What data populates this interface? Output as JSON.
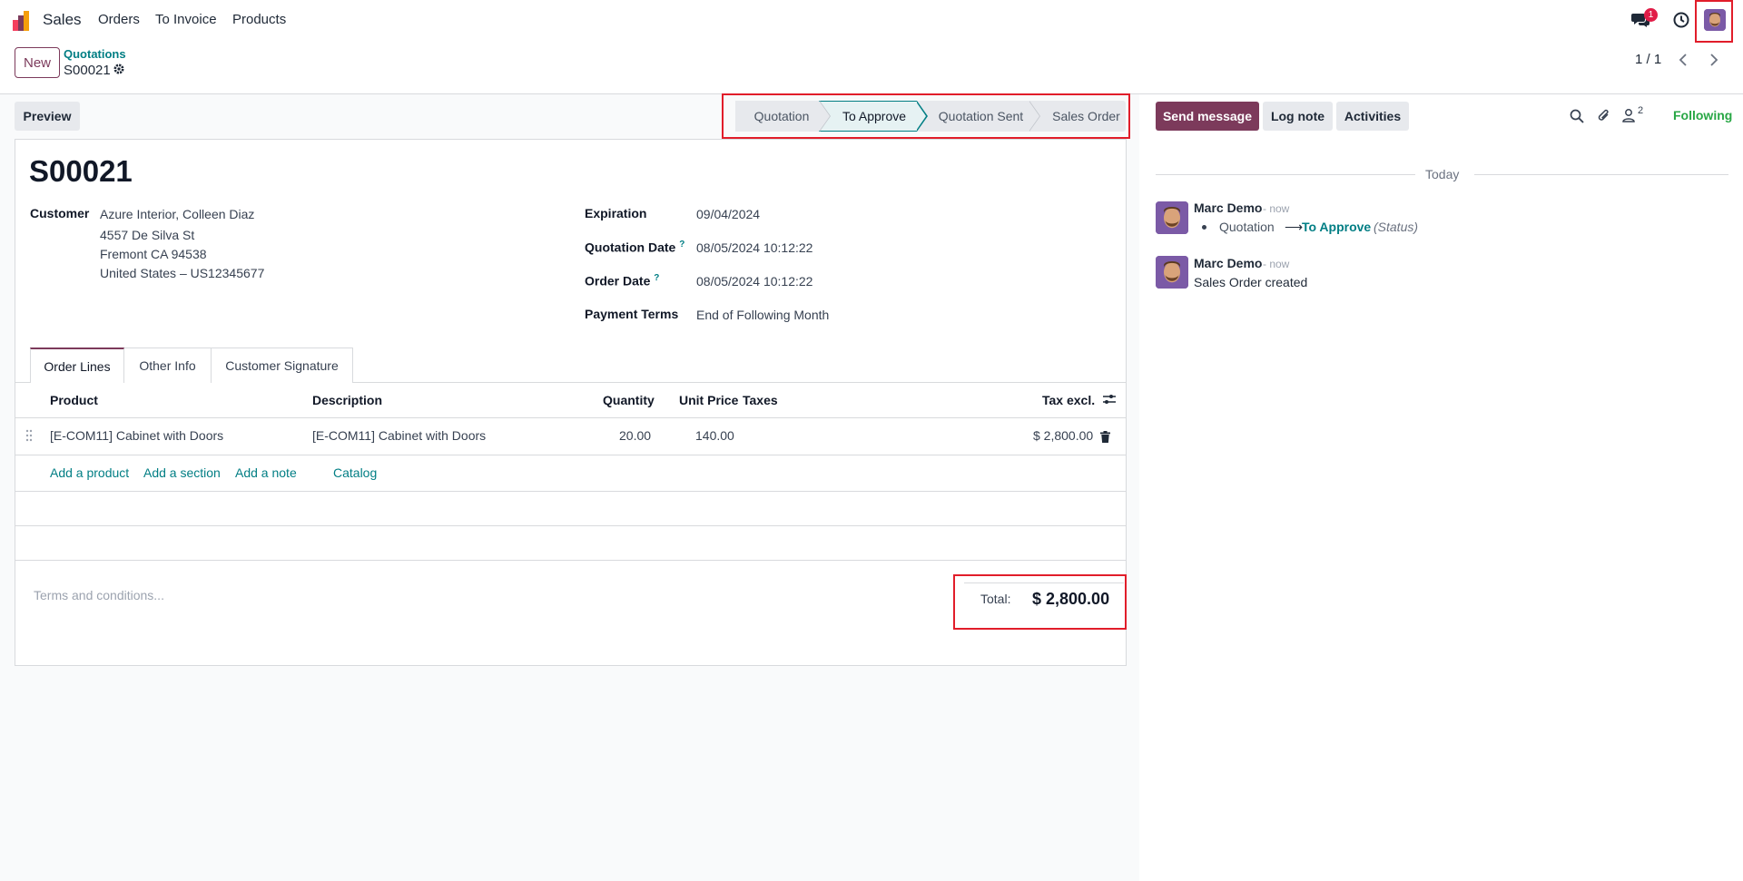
{
  "navbar": {
    "app_name": "Sales",
    "menu": [
      "Orders",
      "To Invoice",
      "Products"
    ],
    "messages_badge": "1"
  },
  "control_panel": {
    "new_label": "New",
    "breadcrumb_parent": "Quotations",
    "breadcrumb_current": "S00021",
    "pager_value": "1 / 1"
  },
  "form": {
    "preview_label": "Preview",
    "stages": [
      "Quotation",
      "To Approve",
      "Quotation Sent",
      "Sales Order"
    ],
    "active_stage": "To Approve",
    "record_name": "S00021",
    "customer_label": "Customer",
    "customer_lines": [
      "Azure Interior, Colleen Diaz",
      "4557 De Silva St",
      "Fremont CA 94538",
      "United States – US12345677"
    ],
    "expiration_label": "Expiration",
    "expiration_value": "09/04/2024",
    "quotation_date_label": "Quotation Date",
    "quotation_date_value": "08/05/2024 10:12:22",
    "order_date_label": "Order Date",
    "order_date_value": "08/05/2024 10:12:22",
    "help_mark": "?",
    "payment_terms_label": "Payment Terms",
    "payment_terms_value": "End of Following Month",
    "tabs": [
      "Order Lines",
      "Other Info",
      "Customer Signature"
    ],
    "columns": {
      "product": "Product",
      "description": "Description",
      "quantity": "Quantity",
      "unit_price": "Unit Price",
      "taxes": "Taxes",
      "subtotal": "Tax excl."
    },
    "lines": [
      {
        "product": "[E-COM11] Cabinet with Doors",
        "description": "[E-COM11] Cabinet with Doors",
        "quantity": "20.00",
        "unit_price": "140.00",
        "taxes": "",
        "subtotal": "$ 2,800.00"
      }
    ],
    "add_links": [
      "Add a product",
      "Add a section",
      "Add a note",
      "Catalog"
    ],
    "terms_placeholder": "Terms and conditions...",
    "total_label": "Total:",
    "total_value": "$ 2,800.00"
  },
  "chatter": {
    "send_message": "Send message",
    "log_note": "Log note",
    "activities": "Activities",
    "followers_count": "2",
    "following": "Following",
    "date_separator": "Today",
    "messages": [
      {
        "author": "Marc Demo",
        "time": "- now",
        "tracking_old": "Quotation",
        "tracking_arrow": "⟶",
        "tracking_new": "To Approve",
        "tracking_field": "(Status)"
      },
      {
        "author": "Marc Demo",
        "time": "- now",
        "body": "Sales Order created"
      }
    ]
  },
  "colors": {
    "brand": "#7c3a5b",
    "link": "#017e84",
    "following": "#28a745",
    "highlight_box": "#e11d2a"
  }
}
